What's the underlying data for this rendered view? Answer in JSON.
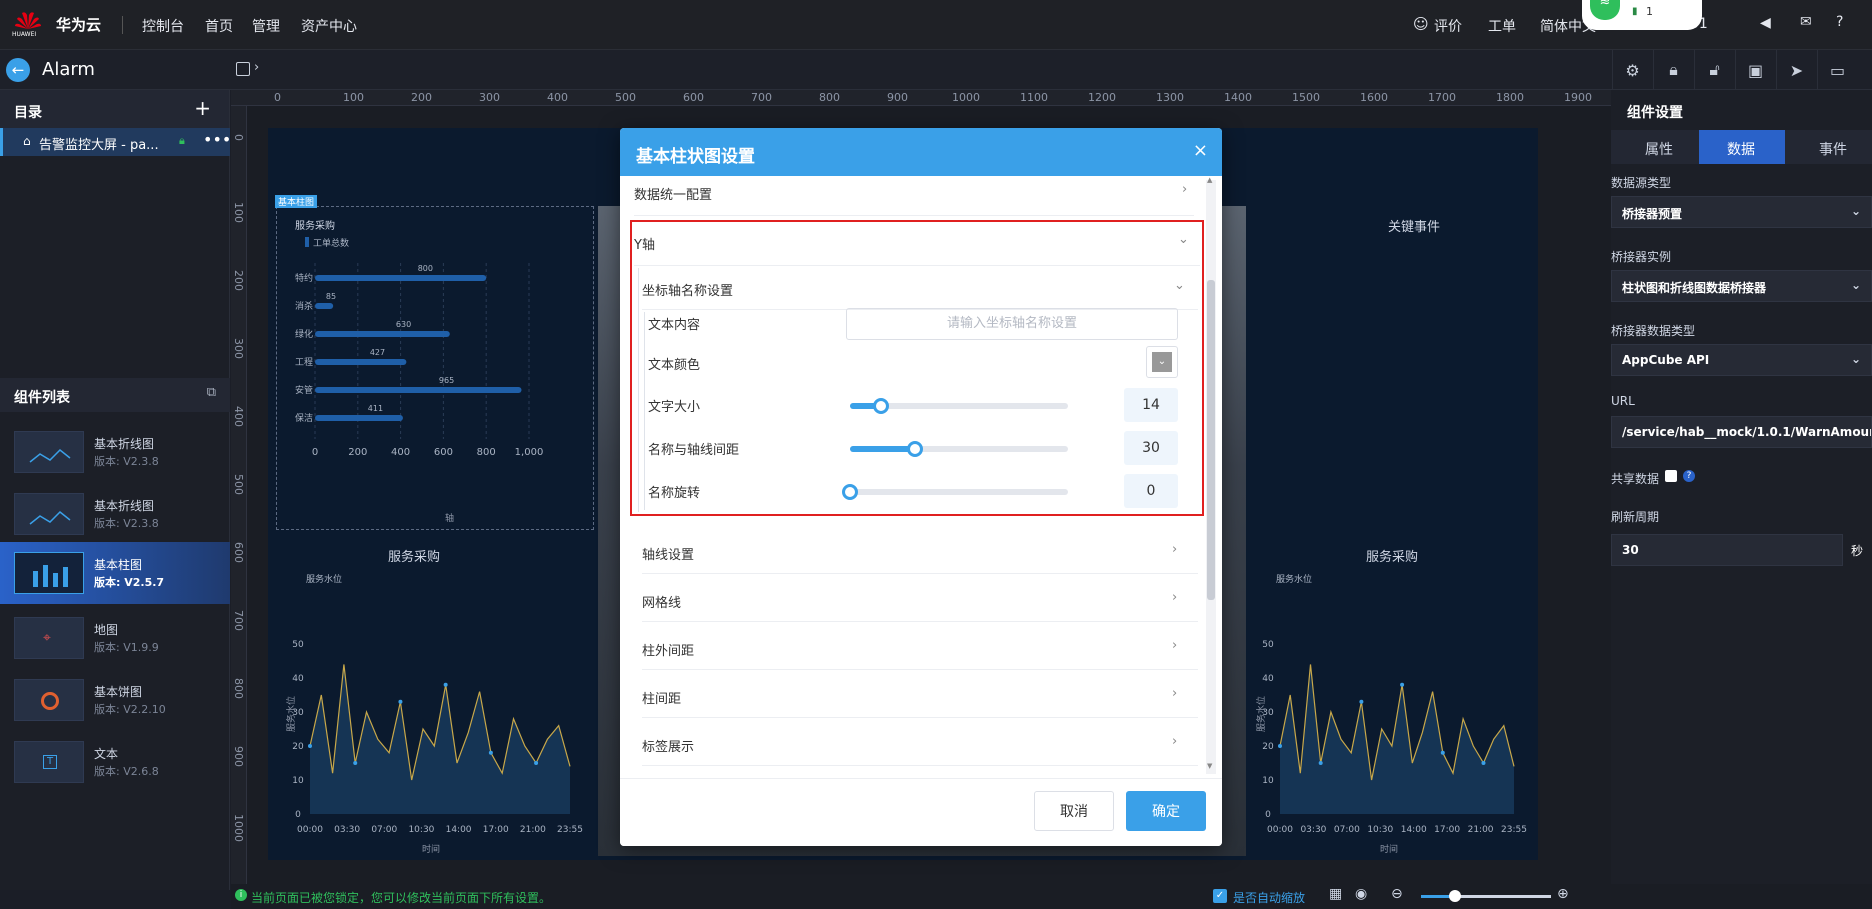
{
  "topbar": {
    "brand_name": "华为云",
    "brand_small": "HUAWEI",
    "nav": [
      "控制台",
      "首页",
      "管理",
      "资产中心"
    ],
    "right_links": [
      "评价",
      "工单",
      "简体中文",
      "51"
    ],
    "wifi_count": "1"
  },
  "appbar": {
    "title": "Alarm"
  },
  "leftpanel": {
    "catalog_title": "目录",
    "page_item": "告警监控大屏 - pa...",
    "components_title": "组件列表",
    "components": [
      {
        "name": "基本折线图",
        "version": "版本: V2.3.8"
      },
      {
        "name": "基本折线图",
        "version": "版本: V2.3.8"
      },
      {
        "name": "基本柱图",
        "version": "版本: V2.5.7"
      },
      {
        "name": "地图",
        "version": "版本: V1.9.9"
      },
      {
        "name": "基本饼图",
        "version": "版本: V2.2.10"
      },
      {
        "name": "文本",
        "version": "版本: V2.6.8"
      }
    ]
  },
  "ruler": {
    "top": [
      "0",
      "100",
      "200",
      "300",
      "400",
      "500",
      "600",
      "700",
      "800",
      "900",
      "1000",
      "1100",
      "1200",
      "1300",
      "1400",
      "1500",
      "1600",
      "1700",
      "1800",
      "1900"
    ],
    "left": [
      "0",
      "100",
      "200",
      "300",
      "400",
      "500",
      "600",
      "700",
      "800",
      "900",
      "1000"
    ]
  },
  "stage": {
    "bar_tag": "基本柱图",
    "bar_title": "服务采购",
    "bar_legend": "工单总数",
    "bar_axis_label": "轴",
    "key_events": "关键事件",
    "left_line_title": "服务采购",
    "right_line_title": "服务采购",
    "line_legend": "服务水位",
    "line_ylabel": "服务水位",
    "line_xlabel": "时间"
  },
  "chart_data": [
    {
      "type": "bar",
      "orientation": "horizontal",
      "title": "服务采购",
      "categories": [
        "特约",
        "消杀",
        "绿化",
        "工程",
        "安管",
        "保洁"
      ],
      "series": [
        {
          "name": "工单总数",
          "values": [
            800,
            85,
            630,
            427,
            965,
            411
          ]
        }
      ],
      "xlim": [
        0,
        1000
      ],
      "xticks": [
        "0",
        "200",
        "400",
        "600",
        "800",
        "1,000"
      ],
      "grid": true
    },
    {
      "type": "line",
      "title": "服务采购",
      "series": [
        {
          "name": "服务水位",
          "values": [
            20,
            35,
            12,
            44,
            15,
            30,
            22,
            18,
            33,
            10,
            25,
            20,
            38,
            15,
            24,
            36,
            18,
            12,
            28,
            20,
            15,
            22,
            26,
            14
          ]
        }
      ],
      "x_ticks": [
        "00:00",
        "03:30",
        "07:00",
        "10:30",
        "14:00",
        "17:00",
        "21:00",
        "23:55"
      ],
      "ylim": [
        0,
        50
      ],
      "yticks": [
        "0",
        "10",
        "20",
        "30",
        "40",
        "50"
      ],
      "xlabel": "时间",
      "ylabel": "服务水位"
    },
    {
      "type": "line",
      "title": "服务采购",
      "series": [
        {
          "name": "服务水位",
          "values": [
            20,
            35,
            12,
            44,
            15,
            30,
            22,
            18,
            33,
            10,
            25,
            20,
            38,
            15,
            24,
            36,
            18,
            12,
            28,
            20,
            15,
            22,
            26,
            14
          ]
        }
      ],
      "x_ticks": [
        "00:00",
        "03:30",
        "07:00",
        "10:30",
        "14:00",
        "17:00",
        "21:00",
        "23:55"
      ],
      "ylim": [
        0,
        50
      ],
      "yticks": [
        "0",
        "10",
        "20",
        "30",
        "40",
        "50"
      ],
      "xlabel": "时间",
      "ylabel": "服务水位"
    }
  ],
  "dialog": {
    "title": "基本柱状图设置",
    "row_unified": "数据统一配置",
    "row_yaxis": "Y轴",
    "row_axisname": "坐标轴名称设置",
    "label_text": "文本内容",
    "text_placeholder": "请输入坐标轴名称设置",
    "label_color": "文本颜色",
    "label_fontsize": "文字大小",
    "fontsize_value": "14",
    "fontsize_fraction": 0.14,
    "label_gap": "名称与轴线间距",
    "gap_value": "30",
    "gap_fraction": 0.3,
    "label_rotate": "名称旋转",
    "rotate_value": "0",
    "rotate_fraction": 0,
    "row_axisline": "轴线设置",
    "row_grid": "网格线",
    "row_outer": "柱外间距",
    "row_inner": "柱间距",
    "row_label": "标签展示",
    "cancel": "取消",
    "ok": "确定"
  },
  "rightpanel": {
    "title": "组件设置",
    "tabs": [
      "属性",
      "数据",
      "事件"
    ],
    "ds_type_label": "数据源类型",
    "ds_type_value": "桥接器预置",
    "bridge_label": "桥接器实例",
    "bridge_value": "柱状图和折线图数据桥接器",
    "bridge_type_label": "桥接器数据类型",
    "bridge_type_value": "AppCube API",
    "url_label": "URL",
    "url_value": "/service/hab__mock/1.0.1/WarnAmountPerSta",
    "share_label": "共享数据",
    "refresh_label": "刷新周期",
    "refresh_value": "30",
    "refresh_unit": "秒"
  },
  "status": {
    "locked_msg": "当前页面已被您锁定，您可以修改当前页面下所有设置。",
    "autoscale": "是否自动缩放"
  },
  "colors": {
    "accent": "#3aa0e8",
    "highlight_border": "#e02020",
    "brand_red": "#e60012"
  }
}
